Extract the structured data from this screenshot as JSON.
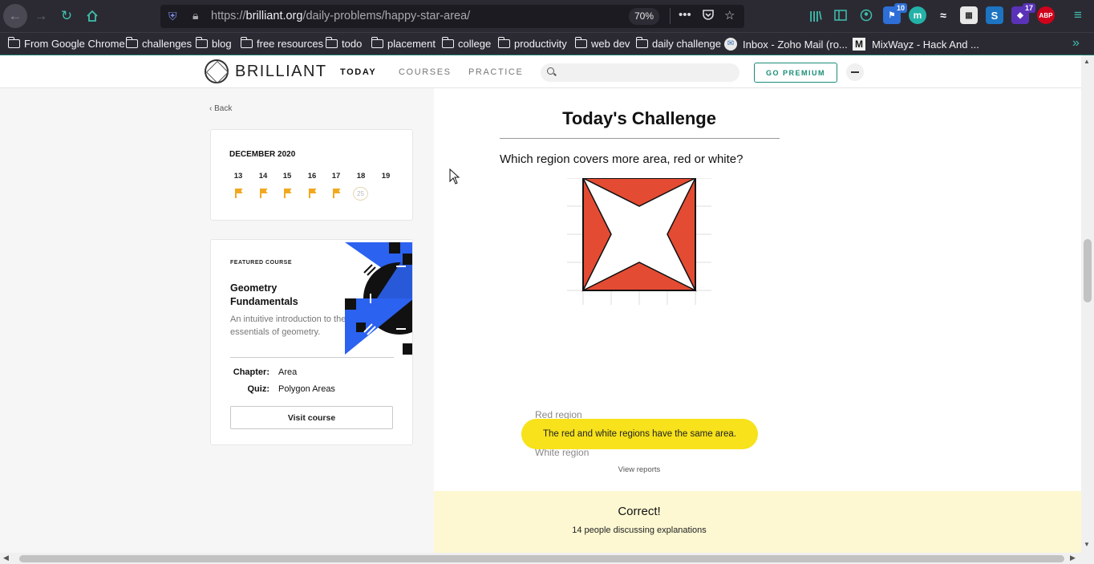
{
  "browser": {
    "url_prefix": "https://",
    "url_host": "brilliant.org",
    "url_path": "/daily-problems/happy-star-area/",
    "zoom": "70%",
    "menu_more": "•••",
    "extension_badges": [
      "10",
      "17"
    ],
    "extension_labels": [
      "m",
      "ABP"
    ],
    "bookmarks": [
      {
        "label": "From Google Chrome",
        "icon": "folder-icon"
      },
      {
        "label": "challenges",
        "icon": "folder-icon"
      },
      {
        "label": "blog",
        "icon": "folder-icon"
      },
      {
        "label": "free resources",
        "icon": "folder-icon"
      },
      {
        "label": "todo",
        "icon": "folder-icon"
      },
      {
        "label": "placement",
        "icon": "folder-icon"
      },
      {
        "label": "college",
        "icon": "folder-icon"
      },
      {
        "label": "productivity",
        "icon": "folder-icon"
      },
      {
        "label": "web dev",
        "icon": "folder-icon"
      },
      {
        "label": "daily challenge",
        "icon": "folder-icon"
      },
      {
        "label": "Inbox - Zoho Mail (ro...",
        "icon": "mail-icon"
      },
      {
        "label": "MixWayz - Hack And ...",
        "icon": "mixwayz-icon"
      }
    ],
    "accent_color": "#3fbfae"
  },
  "site": {
    "brand": "BRILLIANT",
    "nav": [
      {
        "label": "TODAY",
        "active": true
      },
      {
        "label": "COURSES",
        "active": false
      },
      {
        "label": "PRACTICE",
        "active": false
      }
    ],
    "search_placeholder": "",
    "premium_label": "GO PREMIUM",
    "brand_color": "#1a8c77"
  },
  "sidebar": {
    "back_label": "Back",
    "calendar": {
      "month": "DECEMBER 2020",
      "days": [
        "13",
        "14",
        "15",
        "16",
        "17",
        "18",
        "19"
      ],
      "flagged_days": 5,
      "today_badge": "25"
    },
    "course": {
      "tag": "FEATURED COURSE",
      "title": "Geometry Fundamentals",
      "description": "An intuitive introduction to the essentials of geometry.",
      "chapter_key": "Chapter:",
      "chapter_value": "Area",
      "quiz_key": "Quiz:",
      "quiz_value": "Polygon Areas",
      "visit_label": "Visit course"
    }
  },
  "challenge": {
    "title": "Today's Challenge",
    "question": "Which region covers more area, red or white?",
    "options": [
      "Red region",
      "White region"
    ],
    "selected_answer": "The red and white regions have the same area.",
    "reports_label": "View reports",
    "result": "Correct!",
    "discussion": "14 people discussing explanations",
    "figure_colors": {
      "red": "#e44b33",
      "white": "#ffffff"
    }
  }
}
